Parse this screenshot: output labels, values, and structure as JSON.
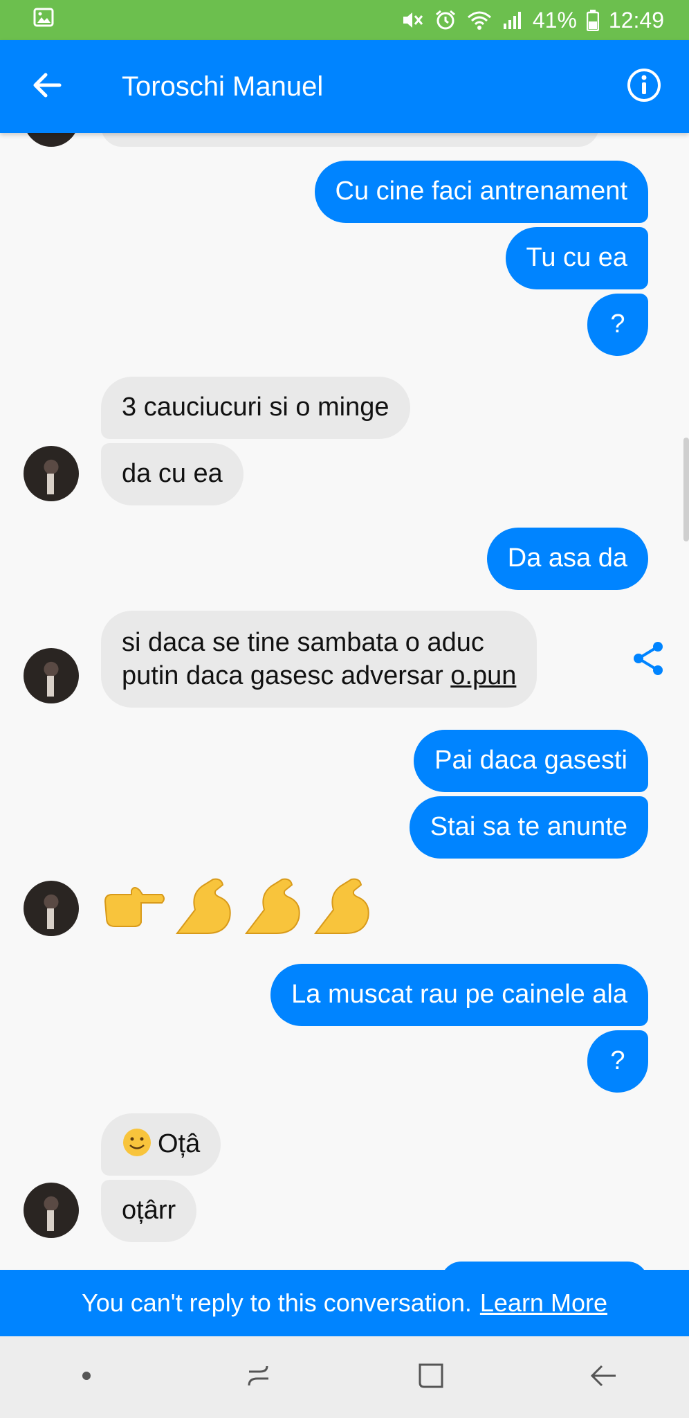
{
  "status_bar": {
    "battery": "41%",
    "time": "12:49"
  },
  "header": {
    "title": "Toroschi Manuel"
  },
  "messages": {
    "m1": "Cu cine faci antrenament",
    "m2": "Tu cu ea",
    "m3": "?",
    "m4": "3 cauciucuri si o minge",
    "m5": "da cu ea",
    "m6": "Da asa da",
    "m7_line1": "si daca se tine sambata o aduc",
    "m7_line2": "putin daca gasesc adversar ",
    "m7_link": "o.pun",
    "m8": "Pai daca gasesti",
    "m9": "Stai sa te anunte",
    "m10": "👉💪💪💪",
    "m11": "La muscat rau pe cainele ala",
    "m12": "?",
    "m13": "Oțâ",
    "m14": "oțârr"
  },
  "banner": {
    "text": "You can't reply to this conversation.",
    "link": "Learn More"
  },
  "icons": {
    "back": "arrow-left-icon",
    "info": "info-icon",
    "share": "share-icon"
  },
  "colors": {
    "messenger_blue": "#0084ff",
    "status_green": "#6cbf4e",
    "incoming_bubble": "#e9e9e9"
  }
}
